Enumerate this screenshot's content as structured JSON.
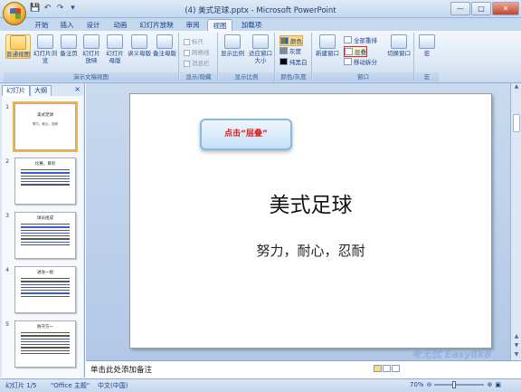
{
  "window": {
    "title": "(4) 美式足球.pptx - Microsoft PowerPoint",
    "controls": [
      "—",
      "□",
      "✕"
    ]
  },
  "qat": [
    "💾",
    "↶",
    "↷",
    "▾"
  ],
  "tabs": [
    {
      "label": "开始"
    },
    {
      "label": "插入"
    },
    {
      "label": "设计"
    },
    {
      "label": "动画"
    },
    {
      "label": "幻灯片放映"
    },
    {
      "label": "审阅"
    },
    {
      "label": "视图"
    },
    {
      "label": "加载项"
    }
  ],
  "active_tab": "视图",
  "ribbon": {
    "groups": [
      {
        "label": "演示文稿视图",
        "buttons": [
          "普通视图",
          "幻灯片浏览",
          "备注页",
          "幻灯片放映",
          "幻灯片母版",
          "讲义母版",
          "备注母版"
        ]
      },
      {
        "label": "显示/隐藏",
        "checks": [
          "标尺",
          "网格线",
          "消息栏"
        ]
      },
      {
        "label": "显示比例",
        "buttons": [
          "显示比例",
          "适应窗口大小"
        ]
      },
      {
        "label": "颜色/灰度",
        "items": [
          "颜色",
          "灰度",
          "纯黑白"
        ]
      },
      {
        "label": "窗口",
        "buttons": [
          "新建窗口",
          "全部重排",
          "层叠",
          "移动拆分",
          "切换窗口"
        ]
      },
      {
        "label": "宏",
        "buttons": [
          "宏"
        ]
      }
    ]
  },
  "panel": {
    "tabs": [
      "幻灯片",
      "大纲"
    ],
    "close": "×"
  },
  "thumbnails": [
    {
      "num": "1",
      "title": "美式足球",
      "sub": "努力，耐心，忍耐"
    },
    {
      "num": "2",
      "title": "比赛，目的"
    },
    {
      "num": "3",
      "title": "球员组成"
    },
    {
      "num": "4",
      "title": "进攻一组"
    },
    {
      "num": "5",
      "title": "防守方一"
    }
  ],
  "slide": {
    "title": "美式足球",
    "subtitle": "努力，耐心，忍耐"
  },
  "callout": "点击“层叠”",
  "notes_placeholder": "单击此处添加备注",
  "status": {
    "slide": "幻灯片 1/5",
    "theme": "\"Office 主题\"",
    "lang": "中文(中国)",
    "zoom": "70%"
  },
  "watermark": "考无忧 Easy8k8"
}
